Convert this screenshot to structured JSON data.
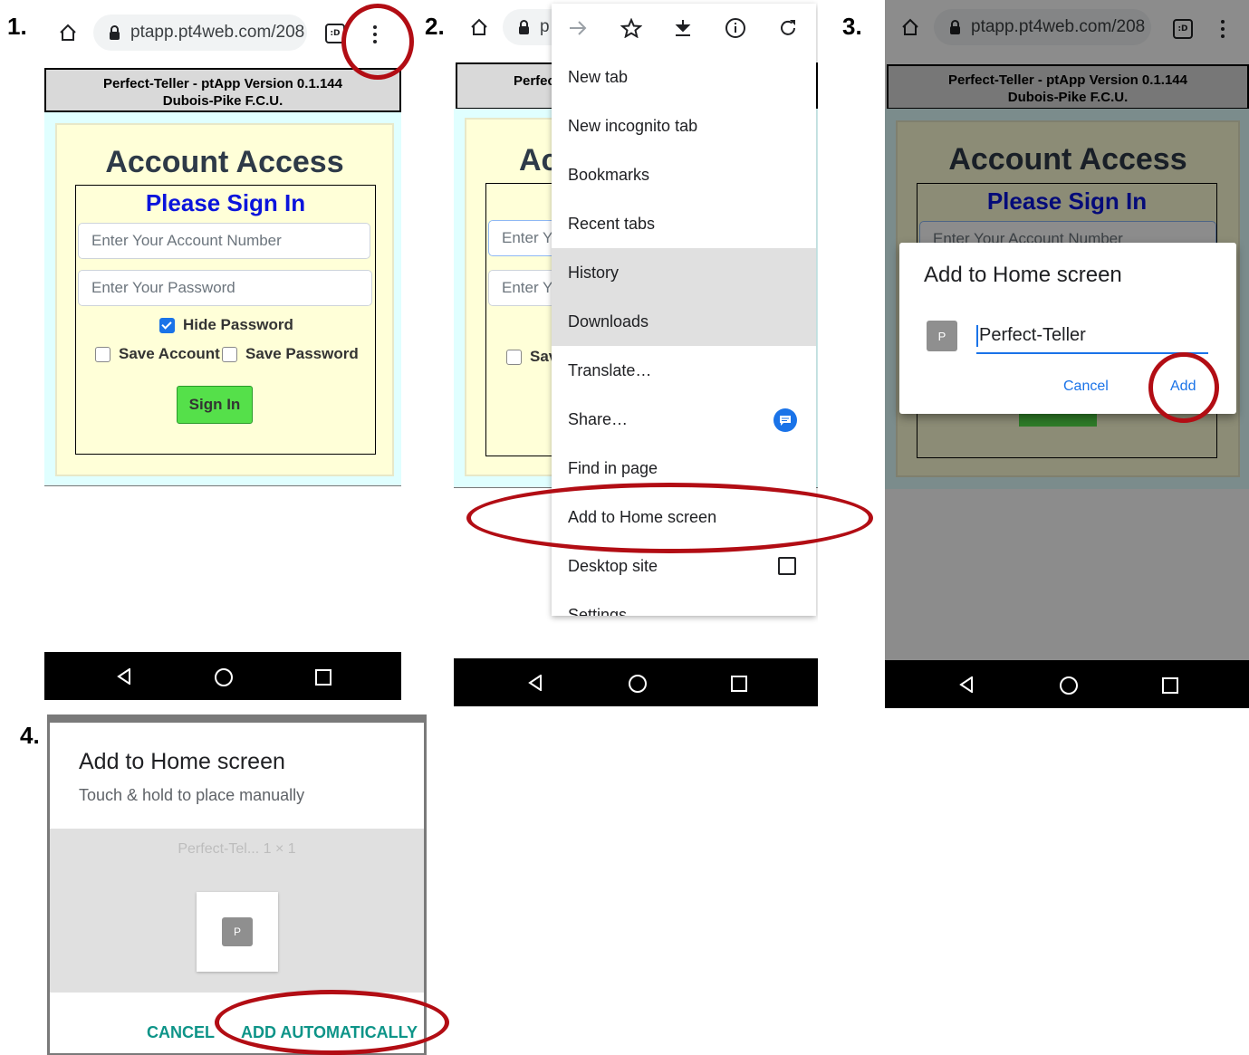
{
  "steps": [
    "1.",
    "2.",
    "3.",
    "4."
  ],
  "browser": {
    "url": "ptapp.pt4web.com/208",
    "url_short": "p",
    "tab_count": ":D"
  },
  "site": {
    "header_line1": "Perfect-Teller - ptApp Version 0.1.144",
    "header_line2": "Dubois-Pike F.C.U.",
    "header_short": "Perfec",
    "access_title": "Account Access",
    "access_short": "Ac",
    "signin_title": "Please Sign In",
    "account_placeholder": "Enter Your Account Number",
    "password_placeholder": "Enter Your Password",
    "placeholder_short": "Enter Y",
    "hide_password": "Hide Password",
    "save_account": "Save Account",
    "save_password": "Save Password",
    "save_short": "Sav",
    "signin_button": "Sign In"
  },
  "menu": {
    "items": [
      "New tab",
      "New incognito tab",
      "Bookmarks",
      "Recent tabs",
      "History",
      "Downloads",
      "Translate…",
      "Share…",
      "Find in page",
      "Add to Home screen",
      "Desktop site"
    ],
    "cutoff": "Settings"
  },
  "dialog3": {
    "title": "Add to Home screen",
    "icon_letter": "P",
    "name_value": "Perfect-Teller",
    "cancel": "Cancel",
    "add": "Add"
  },
  "dialog4": {
    "title": "Add to Home screen",
    "subtitle": "Touch & hold to place manually",
    "widget_label": "Perfect-Tel...  1 × 1",
    "icon_letter": "P",
    "cancel": "CANCEL",
    "add_auto": "ADD AUTOMATICALLY"
  },
  "colors": {
    "highlight_ring": "#b20d14",
    "signin_title": "#0a14dc",
    "dialog_button": "#1a73e8",
    "dialog4_button": "#0d9488"
  }
}
